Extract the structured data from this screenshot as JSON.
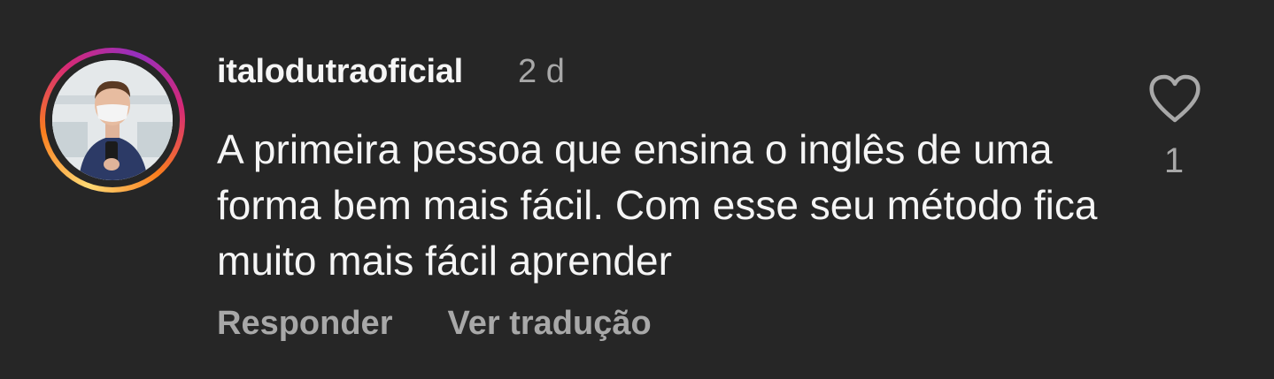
{
  "comment": {
    "username": "italodutraoficial",
    "time": "2 d",
    "text": "A primeira pessoa que ensina o inglês de uma forma bem mais fácil. Com esse seu método fica muito mais fácil aprender",
    "like_count": "1"
  },
  "actions": {
    "reply_label": "Responder",
    "translate_label": "Ver tradução"
  },
  "icons": {
    "like": "heart-outline-icon",
    "avatar": "profile-photo"
  },
  "colors": {
    "background": "#262626",
    "primary_text": "#f5f5f5",
    "secondary_text": "#a8a8a8",
    "story_ring": [
      "#feda75",
      "#fa7e1e",
      "#d62976",
      "#962fbf"
    ]
  }
}
